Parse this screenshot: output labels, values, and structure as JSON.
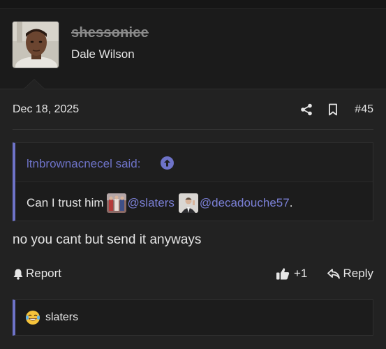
{
  "post": {
    "username": "shessonice",
    "user_title": "Dale Wilson",
    "date": "Dec 18, 2025",
    "post_number": "#45",
    "quote": {
      "author_label": "ltnbrownacnecel said:",
      "text_before": "Can I trust him",
      "mention_1": "@slaters",
      "mention_2": "@decadouche57",
      "text_after": "."
    },
    "message": "no you cant but send it anyways",
    "actions": {
      "report_label": "Report",
      "like_count": "+1",
      "reply_label": "Reply"
    },
    "reactions": {
      "users": "slaters",
      "emoji_icon": "laughing-tears-emoji"
    }
  },
  "colors": {
    "accent": "#6e73c8",
    "background": "#1b1b1b",
    "post_background": "#222222"
  }
}
